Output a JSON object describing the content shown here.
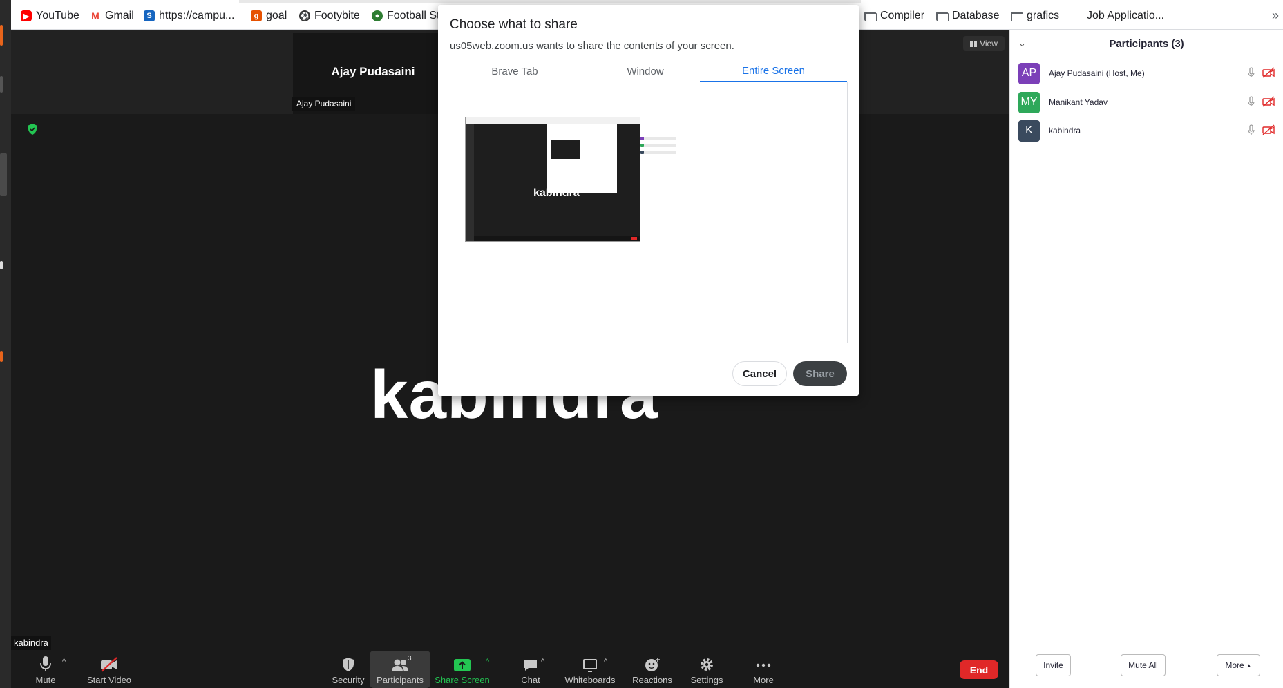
{
  "bookmarks": [
    {
      "label": "YouTube",
      "icon": "youtube-icon",
      "color": "#ff0000"
    },
    {
      "label": "Gmail",
      "icon": "gmail-icon",
      "color": "#ea4335"
    },
    {
      "label": "https://campu...",
      "icon": "site-s-icon",
      "color": "#1565c0"
    },
    {
      "label": "goal",
      "icon": "goal-icon",
      "color": "#e65100"
    },
    {
      "label": "Footybite",
      "icon": "football-icon",
      "color": "#333333"
    },
    {
      "label": "Football St",
      "icon": "football-stream-icon",
      "color": "#2e7d32"
    }
  ],
  "bookmark_folders": [
    {
      "label": "Compiler",
      "icon": "folder-icon"
    },
    {
      "label": "Database",
      "icon": "folder-icon"
    },
    {
      "label": "grafics",
      "icon": "folder-icon"
    }
  ],
  "bookmark_extra": {
    "label": "Job Applicatio..."
  },
  "meeting": {
    "thumbnail_name": "Ajay Pudasaini",
    "thumbnail_tag": "Ajay Pudasaini",
    "view_label": "View",
    "active_speaker": "kabindra",
    "active_tag": "kabindra"
  },
  "toolbar": {
    "mute": "Mute",
    "start_video": "Start Video",
    "security": "Security",
    "participants": "Participants",
    "participant_count": "3",
    "share_screen": "Share Screen",
    "chat": "Chat",
    "whiteboards": "Whiteboards",
    "reactions": "Reactions",
    "settings": "Settings",
    "more": "More",
    "end": "End"
  },
  "panel": {
    "title": "Participants (3)",
    "participants": [
      {
        "initials": "AP",
        "name": "Ajay Pudasaini (Host, Me)",
        "color": "#7b3fb8"
      },
      {
        "initials": "MY",
        "name": "Manikant Yadav",
        "color": "#2ea85a"
      },
      {
        "initials": "K",
        "name": "kabindra",
        "color": "#3a4a5e"
      }
    ],
    "invite": "Invite",
    "mute_all": "Mute All",
    "more": "More"
  },
  "dialog": {
    "title": "Choose what to share",
    "subtitle": "us05web.zoom.us wants to share the contents of your screen.",
    "tabs": [
      "Brave Tab",
      "Window",
      "Entire Screen"
    ],
    "active_tab": "Entire Screen",
    "preview_name": "kabindra",
    "cancel": "Cancel",
    "share": "Share"
  },
  "colors": {
    "accent": "#1a73e8",
    "end_red": "#e02828",
    "share_green": "#23c552",
    "video_off_red": "#e02828"
  }
}
